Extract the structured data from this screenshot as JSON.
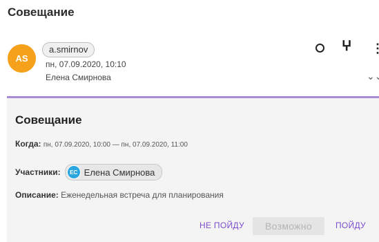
{
  "page": {
    "title": "Совещание"
  },
  "message": {
    "avatar_initials": "AS",
    "avatar_color": "#f5a11c",
    "sender": "a.smirnov",
    "date": "пн, 07.09.2020, 10:10",
    "name": "Елена Смирнова",
    "icons": [
      "circle-icon",
      "translate-icon",
      "more-vert-icon",
      "expand-icon"
    ]
  },
  "event": {
    "accent_color": "#a78bd4",
    "title": "Совещание",
    "when_label": "Когда:",
    "when_value": "пн, 07.09.2020, 10:00 — пн, 07.09.2020, 11:00",
    "participants_label": "Участники:",
    "participant": {
      "initials": "ЕС",
      "name": "Елена Смирнова"
    },
    "description_label": "Описание:",
    "description_value": "Еженедельная встреча для планирования",
    "buttons": {
      "decline": "НЕ ПОЙДУ",
      "maybe": "Возможно",
      "accept": "ПОЙДУ"
    }
  }
}
